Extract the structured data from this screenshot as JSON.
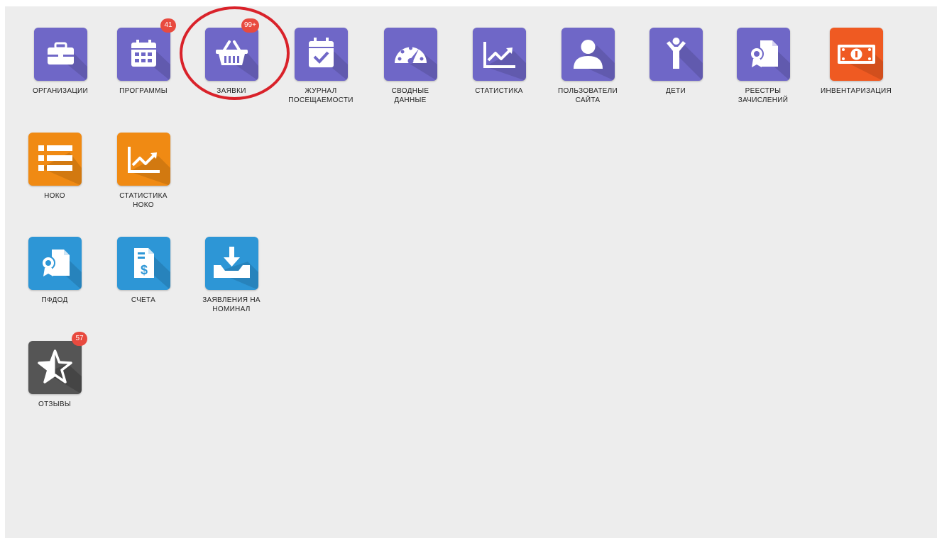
{
  "colors": {
    "purple": "#6f67c7",
    "orange": "#f08a13",
    "orange_red": "#ef5a22",
    "blue": "#2d96d6",
    "grey": "#555555",
    "badge": "#e84a3f",
    "highlight": "#d9222a"
  },
  "tiles": {
    "organizations": {
      "label": "ОРГАНИЗАЦИИ",
      "icon": "briefcase-icon"
    },
    "programs": {
      "label": "ПРОГРАММЫ",
      "icon": "calendar-grid-icon",
      "badge": "41"
    },
    "applications": {
      "label": "ЗАЯВКИ",
      "icon": "basket-icon",
      "badge": "99+"
    },
    "attendance": {
      "label": "ЖУРНАЛ\nПОСЕЩАЕМОСТИ",
      "icon": "calendar-check-icon"
    },
    "summary": {
      "label": "СВОДНЫЕ\nДАННЫЕ",
      "icon": "speedometer-icon"
    },
    "statistics": {
      "label": "СТАТИСТИКА",
      "icon": "line-chart-icon"
    },
    "site_users": {
      "label": "ПОЛЬЗОВАТЕЛИ\nСАЙТА",
      "icon": "user-icon"
    },
    "children": {
      "label": "ДЕТИ",
      "icon": "child-icon"
    },
    "registers": {
      "label": "РЕЕСТРЫ\nЗАЧИСЛЕНИЙ",
      "icon": "certificate-document-icon"
    },
    "inventory": {
      "label": "ИНВЕНТАРИЗАЦИЯ",
      "icon": "money-bill-icon"
    },
    "noko": {
      "label": "НОКО",
      "icon": "list-icon"
    },
    "noko_statistics": {
      "label": "СТАТИСТИКА\nНОКО",
      "icon": "line-chart-icon"
    },
    "pfdod": {
      "label": "ПФДОД",
      "icon": "certificate-document-icon"
    },
    "invoices": {
      "label": "СЧЕТА",
      "icon": "invoice-dollar-icon"
    },
    "nominal_statements": {
      "label": "ЗАЯВЛЕНИЯ НА\nНОМИНАЛ",
      "icon": "download-tray-icon"
    },
    "reviews": {
      "label": "ОТЗЫВЫ",
      "icon": "star-half-icon",
      "badge": "57"
    }
  }
}
